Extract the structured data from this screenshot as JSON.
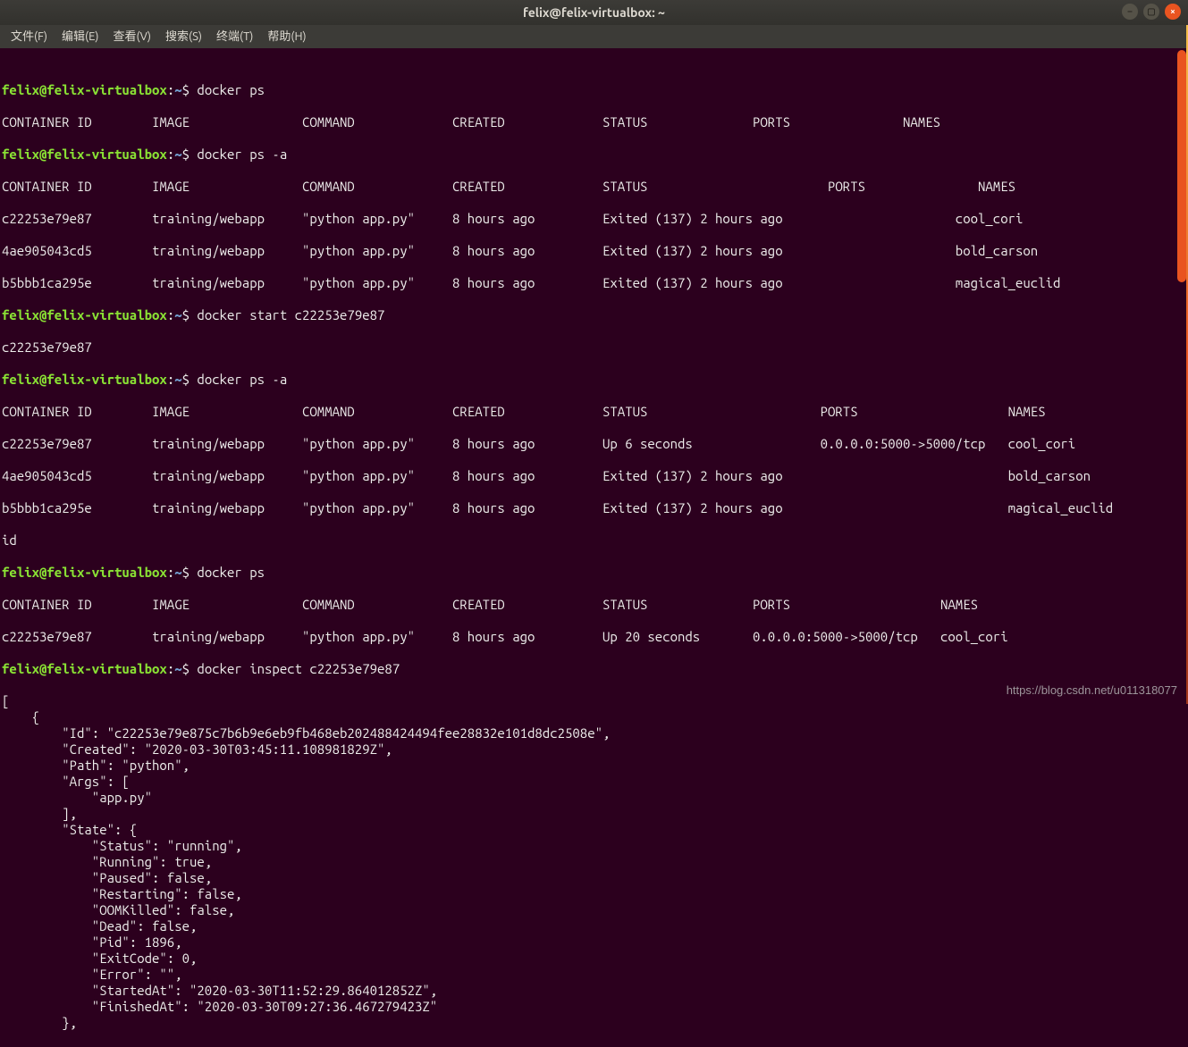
{
  "window": {
    "title": "felix@felix-virtualbox: ~"
  },
  "menu": {
    "file": "文件(F)",
    "edit": "编辑(E)",
    "view": "查看(V)",
    "search": "搜索(S)",
    "terminal": "终端(T)",
    "help": "帮助(H)"
  },
  "prompt": {
    "user_host": "felix@felix-virtualbox",
    "sep": ":",
    "path": "~",
    "dollar": "$"
  },
  "cmds": {
    "c1": " docker ps",
    "c2": " docker ps -a",
    "c3": " docker start c22253e79e87",
    "c4": " docker ps -a",
    "c5": " docker ps",
    "c6": " docker inspect c22253e79e87"
  },
  "out": {
    "header_short": "CONTAINER ID        IMAGE               COMMAND             CREATED             STATUS              PORTS               NAMES",
    "header_wide": "CONTAINER ID        IMAGE               COMMAND             CREATED             STATUS                        PORTS               NAMES",
    "header_ports": "CONTAINER ID        IMAGE               COMMAND             CREATED             STATUS              PORTS                    NAMES",
    "psa1_r1": "c22253e79e87        training/webapp     \"python app.py\"     8 hours ago         Exited (137) 2 hours ago                       cool_cori",
    "psa1_r2": "4ae905043cd5        training/webapp     \"python app.py\"     8 hours ago         Exited (137) 2 hours ago                       bold_carson",
    "psa1_r3": "b5bbb1ca295e        training/webapp     \"python app.py\"     8 hours ago         Exited (137) 2 hours ago                       magical_euclid",
    "start_echo": "c22253e79e87",
    "psa2_h": "CONTAINER ID        IMAGE               COMMAND             CREATED             STATUS                       PORTS                    NAMES",
    "psa2_r1": "c22253e79e87        training/webapp     \"python app.py\"     8 hours ago         Up 6 seconds                 0.0.0.0:5000->5000/tcp   cool_cori",
    "psa2_r2": "4ae905043cd5        training/webapp     \"python app.py\"     8 hours ago         Exited (137) 2 hours ago                              bold_carson",
    "psa2_r3": "b5bbb1ca295e        training/webapp     \"python app.py\"     8 hours ago         Exited (137) 2 hours ago                              magical_euclid",
    "psa2_wrap": "id",
    "ps2_r1": "c22253e79e87        training/webapp     \"python app.py\"     8 hours ago         Up 20 seconds       0.0.0.0:5000->5000/tcp   cool_cori",
    "inspect": [
      "[",
      "    {",
      "        \"Id\": \"c22253e79e875c7b6b9e6eb9fb468eb202488424494fee28832e101d8dc2508e\",",
      "        \"Created\": \"2020-03-30T03:45:11.108981829Z\",",
      "        \"Path\": \"python\",",
      "        \"Args\": [",
      "            \"app.py\"",
      "        ],",
      "        \"State\": {",
      "            \"Status\": \"running\",",
      "            \"Running\": true,",
      "            \"Paused\": false,",
      "            \"Restarting\": false,",
      "            \"OOMKilled\": false,",
      "            \"Dead\": false,",
      "            \"Pid\": 1896,",
      "            \"ExitCode\": 0,",
      "            \"Error\": \"\",",
      "            \"StartedAt\": \"2020-03-30T11:52:29.864012852Z\",",
      "            \"FinishedAt\": \"2020-03-30T09:27:36.467279423Z\"",
      "        },"
    ]
  },
  "watermark": "https://blog.csdn.net/u011318077"
}
